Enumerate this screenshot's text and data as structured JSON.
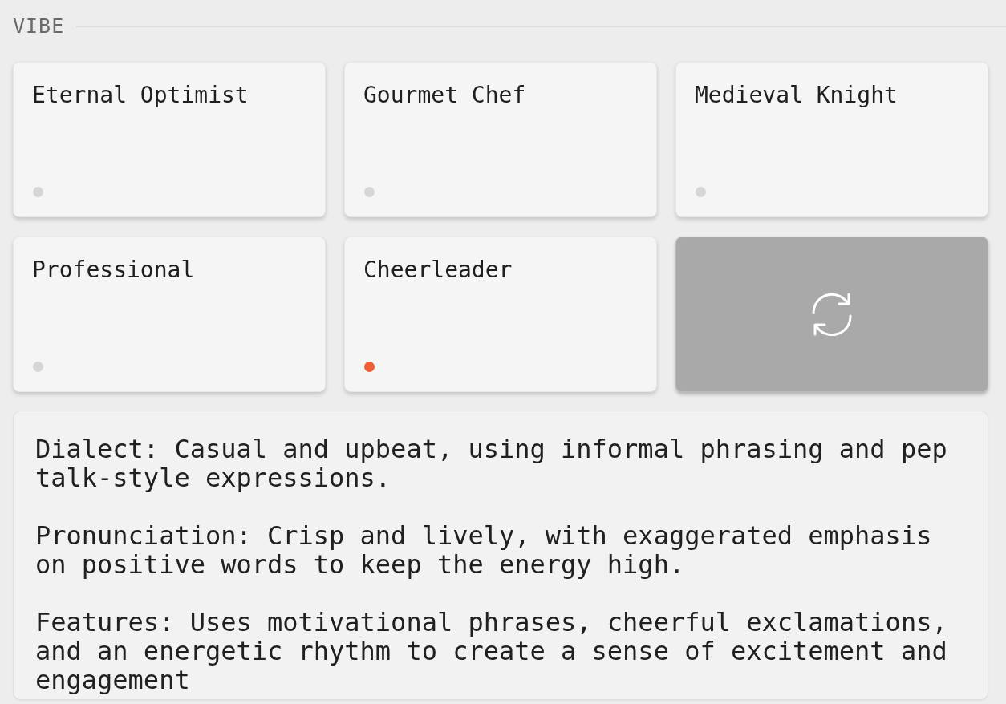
{
  "section": {
    "title": "VIBE"
  },
  "vibes": [
    {
      "name": "Eternal Optimist",
      "selected": false
    },
    {
      "name": "Gourmet Chef",
      "selected": false
    },
    {
      "name": "Medieval Knight",
      "selected": false
    },
    {
      "name": "Professional",
      "selected": false
    },
    {
      "name": "Cheerleader",
      "selected": true
    }
  ],
  "description": {
    "value": "Dialect: Casual and upbeat, using informal phrasing and pep talk-style expressions.\n\nPronunciation: Crisp and lively, with exaggerated emphasis on positive words to keep the energy high.\n\nFeatures: Uses motivational phrases, cheerful exclamations, and an energetic rhythm to create a sense of excitement and engagement"
  }
}
